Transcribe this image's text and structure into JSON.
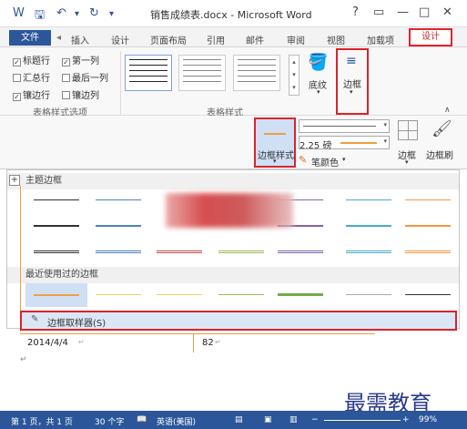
{
  "window": {
    "title": "销售成绩表.docx - Microsoft Word",
    "help": "?",
    "controls": [
      "▭",
      "—",
      "□",
      "✕"
    ]
  },
  "qat": {
    "word_icon": "W",
    "save_icon": "💾",
    "undo_icon": "↶",
    "redo_icon": "↻",
    "custom_icon": "▾"
  },
  "tabs": {
    "file": "文件",
    "items": [
      "插入",
      "设计",
      "页面布局",
      "引用",
      "邮件",
      "审阅",
      "视图",
      "加载项"
    ],
    "active": "设计"
  },
  "table_style_options": {
    "checkboxes": [
      {
        "label": "标题行",
        "checked": true
      },
      {
        "label": "第一列",
        "checked": true
      },
      {
        "label": "汇总行",
        "checked": false
      },
      {
        "label": "最后一列",
        "checked": false
      },
      {
        "label": "镶边行",
        "checked": true
      },
      {
        "label": "镶边列",
        "checked": false
      }
    ],
    "group_label": "表格样式选项"
  },
  "table_styles": {
    "group_label": "表格样式",
    "shading_label": "底纹"
  },
  "borders": {
    "label": "边框"
  },
  "row2": {
    "border_styles_label": "边框样式",
    "weight_value": "2.25 磅",
    "pen_color_label": "笔颜色",
    "borders_label": "边框",
    "border_painter_label": "边框刷"
  },
  "gallery": {
    "theme_header": "主题边框",
    "recent_header": "最近使用过的边框",
    "picker_label": "边框取样器(S)"
  },
  "document": {
    "cell1": "2014/4/4",
    "cell2": "82"
  },
  "status": {
    "page": "第 1 页，共 1 页",
    "words": "30 个字",
    "language": "英语(美国)",
    "zoom": "99%"
  },
  "watermark": "最需教育",
  "colors": {
    "accent": "#2b579a",
    "highlight": "#d9242a",
    "orange_line": "#f0a040"
  }
}
